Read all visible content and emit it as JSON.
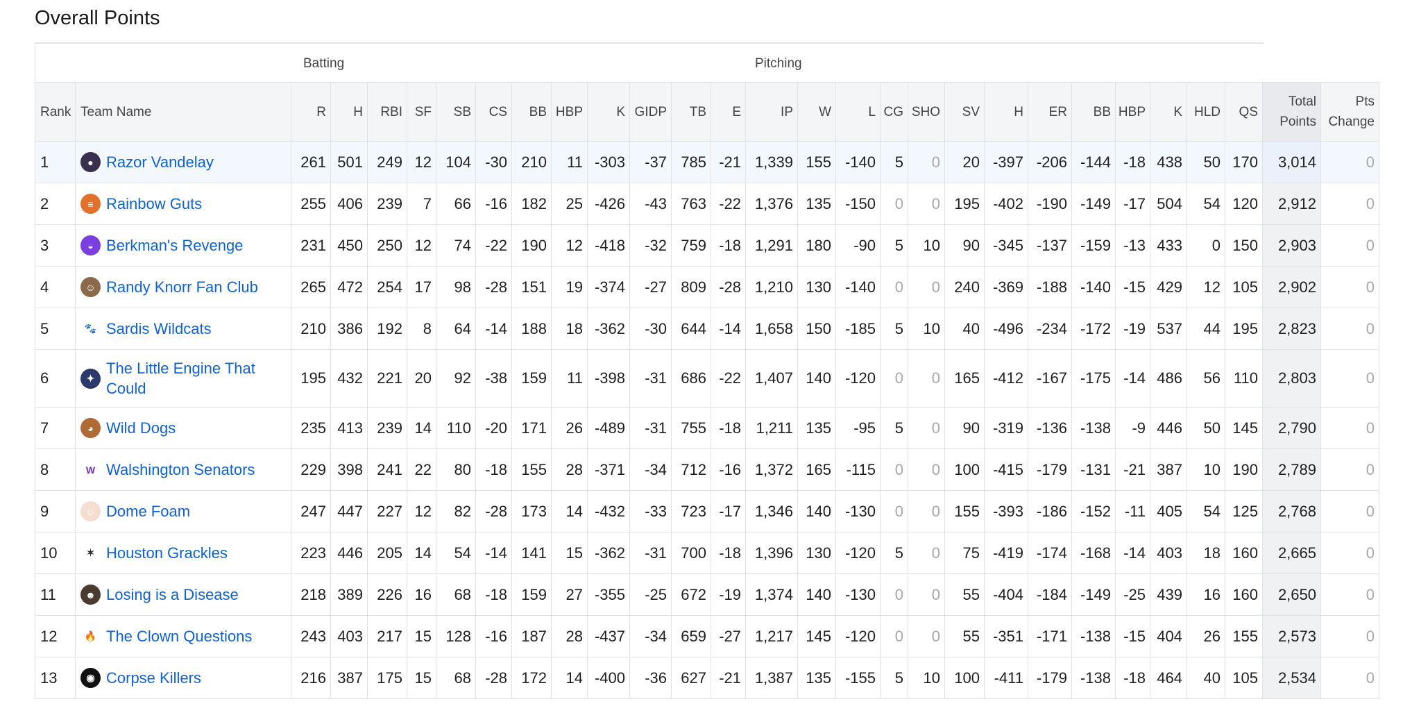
{
  "title": "Overall Points",
  "groups": {
    "batting": "Batting",
    "pitching": "Pitching"
  },
  "headers": [
    "Rank",
    "Team Name",
    "R",
    "H",
    "RBI",
    "SF",
    "SB",
    "CS",
    "BB",
    "HBP",
    "K",
    "GIDP",
    "TB",
    "E",
    "IP",
    "W",
    "L",
    "CG",
    "SHO",
    "SV",
    "H",
    "ER",
    "BB",
    "HBP",
    "K",
    "HLD",
    "QS",
    "Total Points",
    "Pts Change"
  ],
  "teams": [
    {
      "rank": "1",
      "name": "Razor Vandelay",
      "logo": {
        "icon": "flame-ball-icon",
        "bg": "#3a2f4d",
        "glyph": "●"
      },
      "stats": [
        "261",
        "501",
        "249",
        "12",
        "104",
        "-30",
        "210",
        "11",
        "-303",
        "-37",
        "785",
        "-21",
        "1,339",
        "155",
        "-140",
        "5",
        "0",
        "20",
        "-397",
        "-206",
        "-144",
        "-18",
        "438",
        "50",
        "170"
      ],
      "total": "3,014",
      "change": "0"
    },
    {
      "rank": "2",
      "name": "Rainbow Guts",
      "logo": {
        "icon": "striped-ball-icon",
        "bg": "#e0702a",
        "glyph": "≡"
      },
      "stats": [
        "255",
        "406",
        "239",
        "7",
        "66",
        "-16",
        "182",
        "25",
        "-426",
        "-43",
        "763",
        "-22",
        "1,376",
        "135",
        "-150",
        "0",
        "0",
        "195",
        "-402",
        "-190",
        "-149",
        "-17",
        "504",
        "54",
        "120"
      ],
      "total": "2,912",
      "change": "0"
    },
    {
      "rank": "3",
      "name": "Berkman's Revenge",
      "logo": {
        "icon": "purple-helmet-icon",
        "bg": "#7b3fe0",
        "glyph": "◒"
      },
      "stats": [
        "231",
        "450",
        "250",
        "12",
        "74",
        "-22",
        "190",
        "12",
        "-418",
        "-32",
        "759",
        "-18",
        "1,291",
        "180",
        "-90",
        "5",
        "10",
        "90",
        "-345",
        "-137",
        "-159",
        "-13",
        "433",
        "0",
        "150"
      ],
      "total": "2,903",
      "change": "0"
    },
    {
      "rank": "4",
      "name": "Randy Knorr Fan Club",
      "logo": {
        "icon": "player-photo-icon",
        "bg": "#8a6a4a",
        "glyph": "☺"
      },
      "stats": [
        "265",
        "472",
        "254",
        "17",
        "98",
        "-28",
        "151",
        "19",
        "-374",
        "-27",
        "809",
        "-28",
        "1,210",
        "130",
        "-140",
        "0",
        "0",
        "240",
        "-369",
        "-188",
        "-140",
        "-15",
        "429",
        "12",
        "105"
      ],
      "total": "2,902",
      "change": "0"
    },
    {
      "rank": "5",
      "name": "Sardis Wildcats",
      "logo": {
        "icon": "wildcat-icon",
        "bg": "#ffffff",
        "glyph": "🐾"
      },
      "stats": [
        "210",
        "386",
        "192",
        "8",
        "64",
        "-14",
        "188",
        "18",
        "-362",
        "-30",
        "644",
        "-14",
        "1,658",
        "150",
        "-185",
        "5",
        "10",
        "40",
        "-496",
        "-234",
        "-172",
        "-19",
        "537",
        "44",
        "195"
      ],
      "total": "2,823",
      "change": "0"
    },
    {
      "rank": "6",
      "name": "The Little Engine That Could",
      "logo": {
        "icon": "engine-icon",
        "bg": "#2b3a6b",
        "glyph": "✦"
      },
      "stats": [
        "195",
        "432",
        "221",
        "20",
        "92",
        "-38",
        "159",
        "11",
        "-398",
        "-31",
        "686",
        "-22",
        "1,407",
        "140",
        "-120",
        "0",
        "0",
        "165",
        "-412",
        "-167",
        "-175",
        "-14",
        "486",
        "56",
        "110"
      ],
      "total": "2,803",
      "change": "0"
    },
    {
      "rank": "7",
      "name": "Wild Dogs",
      "logo": {
        "icon": "dog-icon",
        "bg": "#b06a35",
        "glyph": "◕"
      },
      "stats": [
        "235",
        "413",
        "239",
        "14",
        "110",
        "-20",
        "171",
        "26",
        "-489",
        "-31",
        "755",
        "-18",
        "1,211",
        "135",
        "-95",
        "5",
        "0",
        "90",
        "-319",
        "-136",
        "-138",
        "-9",
        "446",
        "50",
        "145"
      ],
      "total": "2,790",
      "change": "0"
    },
    {
      "rank": "8",
      "name": "Walshington Senators",
      "logo": {
        "icon": "w-letter-icon",
        "bg": "#ffffff",
        "glyph": "W"
      },
      "stats": [
        "229",
        "398",
        "241",
        "22",
        "80",
        "-18",
        "155",
        "28",
        "-371",
        "-34",
        "712",
        "-16",
        "1,372",
        "165",
        "-115",
        "0",
        "0",
        "100",
        "-415",
        "-179",
        "-131",
        "-21",
        "387",
        "10",
        "190"
      ],
      "total": "2,789",
      "change": "0"
    },
    {
      "rank": "9",
      "name": "Dome Foam",
      "logo": {
        "icon": "clown-face-icon",
        "bg": "#f5ddd0",
        "glyph": "☺"
      },
      "stats": [
        "247",
        "447",
        "227",
        "12",
        "82",
        "-28",
        "173",
        "14",
        "-432",
        "-33",
        "723",
        "-17",
        "1,346",
        "140",
        "-130",
        "0",
        "0",
        "155",
        "-393",
        "-186",
        "-152",
        "-11",
        "405",
        "54",
        "125"
      ],
      "total": "2,768",
      "change": "0"
    },
    {
      "rank": "10",
      "name": "Houston Grackles",
      "logo": {
        "icon": "grackle-bird-icon",
        "bg": "#ffffff",
        "glyph": "✶"
      },
      "stats": [
        "223",
        "446",
        "205",
        "14",
        "54",
        "-14",
        "141",
        "15",
        "-362",
        "-31",
        "700",
        "-18",
        "1,396",
        "130",
        "-120",
        "5",
        "0",
        "75",
        "-419",
        "-174",
        "-168",
        "-14",
        "403",
        "18",
        "160"
      ],
      "total": "2,665",
      "change": "0"
    },
    {
      "rank": "11",
      "name": "Losing is a Disease",
      "logo": {
        "icon": "person-photo-icon",
        "bg": "#4a3a30",
        "glyph": "☻"
      },
      "stats": [
        "218",
        "389",
        "226",
        "16",
        "68",
        "-18",
        "159",
        "27",
        "-355",
        "-25",
        "672",
        "-19",
        "1,374",
        "140",
        "-130",
        "0",
        "0",
        "55",
        "-404",
        "-184",
        "-149",
        "-25",
        "439",
        "16",
        "160"
      ],
      "total": "2,650",
      "change": "0"
    },
    {
      "rank": "12",
      "name": "The Clown Questions",
      "logo": {
        "icon": "torch-icon",
        "bg": "#ffffff",
        "glyph": "🔥"
      },
      "stats": [
        "243",
        "403",
        "217",
        "15",
        "128",
        "-16",
        "187",
        "28",
        "-437",
        "-34",
        "659",
        "-27",
        "1,217",
        "145",
        "-120",
        "0",
        "0",
        "55",
        "-351",
        "-171",
        "-138",
        "-15",
        "404",
        "26",
        "155"
      ],
      "total": "2,573",
      "change": "0"
    },
    {
      "rank": "13",
      "name": "Corpse Killers",
      "logo": {
        "icon": "eye-icon",
        "bg": "#111111",
        "glyph": "◉"
      },
      "stats": [
        "216",
        "387",
        "175",
        "15",
        "68",
        "-28",
        "172",
        "14",
        "-400",
        "-36",
        "627",
        "-21",
        "1,387",
        "135",
        "-155",
        "5",
        "10",
        "100",
        "-411",
        "-179",
        "-138",
        "-18",
        "464",
        "40",
        "105"
      ],
      "total": "2,534",
      "change": "0"
    }
  ]
}
